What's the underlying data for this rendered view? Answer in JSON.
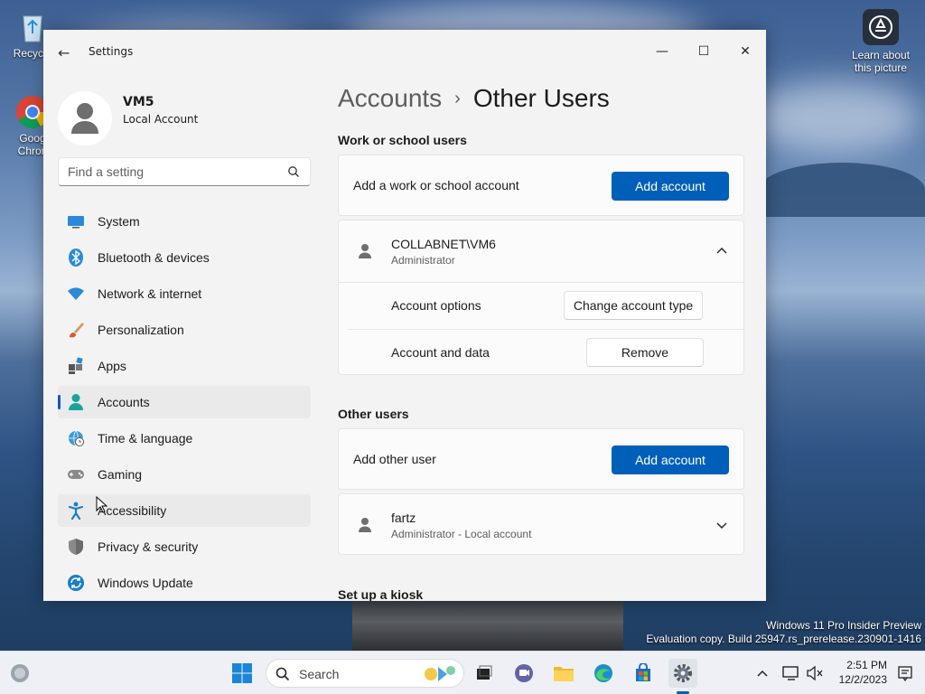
{
  "desktop": {
    "icons": [
      {
        "label": "Recycle"
      },
      {
        "label": "Goog Chron"
      }
    ],
    "learn_label": "Learn about this picture",
    "watermark_line1": "Windows 11 Pro Insider Preview",
    "watermark_line2": "Evaluation copy. Build 25947.rs_prerelease.230901-1416"
  },
  "window": {
    "title": "Settings",
    "back_glyph": "←",
    "minimize_glyph": "—",
    "maximize_glyph": "☐",
    "close_glyph": "✕"
  },
  "profile": {
    "name": "VM5",
    "type": "Local Account"
  },
  "search": {
    "placeholder": "Find a setting"
  },
  "nav": {
    "items": [
      {
        "label": "System",
        "icon": "system-icon"
      },
      {
        "label": "Bluetooth & devices",
        "icon": "bluetooth-icon"
      },
      {
        "label": "Network & internet",
        "icon": "wifi-icon"
      },
      {
        "label": "Personalization",
        "icon": "brush-icon"
      },
      {
        "label": "Apps",
        "icon": "apps-icon"
      },
      {
        "label": "Accounts",
        "icon": "accounts-icon",
        "active": true
      },
      {
        "label": "Time & language",
        "icon": "globe-clock-icon"
      },
      {
        "label": "Gaming",
        "icon": "gamepad-icon"
      },
      {
        "label": "Accessibility",
        "icon": "accessibility-icon"
      },
      {
        "label": "Privacy & security",
        "icon": "shield-icon"
      },
      {
        "label": "Windows Update",
        "icon": "update-icon"
      }
    ]
  },
  "content": {
    "breadcrumb_parent": "Accounts",
    "breadcrumb_sep": "›",
    "breadcrumb_current": "Other Users",
    "work_section": "Work or school users",
    "work_add_label": "Add a work or school account",
    "add_account_button": "Add account",
    "work_user": {
      "name": "COLLABNET\\VM6",
      "role": "Administrator",
      "account_options_label": "Account options",
      "change_type_button": "Change account type",
      "account_data_label": "Account and data",
      "remove_button": "Remove"
    },
    "other_section": "Other users",
    "other_add_label": "Add other user",
    "other_user": {
      "name": "fartz",
      "role": "Administrator - Local account"
    },
    "kiosk_section": "Set up a kiosk"
  },
  "taskbar": {
    "search_label": "Search",
    "time": "2:51 PM",
    "date": "12/2/2023"
  },
  "colors": {
    "accent": "#005fb8"
  }
}
